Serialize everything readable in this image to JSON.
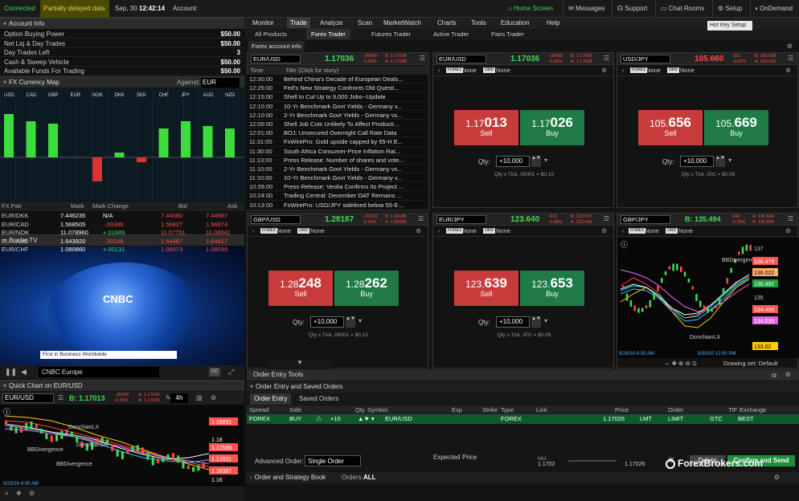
{
  "topbar": {
    "status": "Connected",
    "delay": "Partially delayed data",
    "date": "Sep, 30",
    "time": "12:42:14",
    "account_label": "Account:",
    "home": "Home Screen",
    "messages": "Messages",
    "support": "Support",
    "chat": "Chat Rooms",
    "setup": "Setup",
    "hotkey_tooltip": "Hot Key Setup",
    "ondemand": "OnDemand"
  },
  "account": {
    "title": "Account Info",
    "rows": [
      {
        "label": "Option Buying Power",
        "value": "$50.00"
      },
      {
        "label": "Net Liq & Day Trades",
        "value": "$50.00"
      },
      {
        "label": "Day Trades Left",
        "value": "3"
      },
      {
        "label": "Cash & Sweep Vehicle",
        "value": "$50.00"
      },
      {
        "label": "Available Funds For Trading",
        "value": "$50.00"
      }
    ]
  },
  "fxmap": {
    "title": "FX Currency Map",
    "against_label": "Against:",
    "against": "EUR",
    "currencies": [
      "USD",
      "CAD",
      "GBP",
      "EUR",
      "NOK",
      "DKK",
      "SEK",
      "CHF",
      "JPY",
      "AUD",
      "NZD"
    ]
  },
  "fxtable": {
    "headers": [
      "FX Pair",
      "Mark",
      "Mark Change",
      "Bid",
      "Ask"
    ],
    "rows": [
      {
        "pair": "EUR/DKK",
        "mark": "7.446235",
        "chg": "N/A",
        "bid": "7.44580",
        "ask": "7.44667"
      },
      {
        "pair": "EUR/CAD",
        "mark": "1.568505",
        "chg": "-.00386",
        "bid": "1.56827",
        "ask": "1.56874"
      },
      {
        "pair": "EUR/NOK",
        "mark": "11.078960",
        "chg": "+.01889",
        "bid": "11.07751",
        "ask": "11.08041"
      },
      {
        "pair": "EUR/AUD",
        "mark": "1.643920",
        "chg": "-.00249",
        "bid": "1.64367",
        "ask": "1.64417"
      },
      {
        "pair": "EUR/CHF",
        "mark": "1.080860",
        "chg": "+.00131",
        "bid": "1.08073",
        "ask": "1.08099"
      }
    ]
  },
  "tradertv": {
    "title": "Trader TV",
    "network": "CNBC Europe",
    "ticker": "First in Business Worldwide"
  },
  "quickchart": {
    "title": "Quick Chart on EUR/USD",
    "symbol": "EUR/USD",
    "bid": "B: 1.17013",
    "chg": "-.00426",
    "pct": "-0.36%",
    "a1": "A: 1.17026",
    "a2": "A: 1.17026",
    "tf": "4h",
    "labels": [
      "DonchianLX",
      "BBDivergence",
      "DonchianSE",
      "BBDivergence"
    ],
    "prices": [
      "1.18831",
      "1.18",
      "1.17566",
      "1.17011",
      "1.16367",
      "1.16"
    ],
    "date": "9/29/20 4:00 AM"
  },
  "menu": [
    "Monitor",
    "Trade",
    "Analyze",
    "Scan",
    "MarketWatch",
    "Charts",
    "Tools",
    "Education",
    "Help"
  ],
  "subtabs": [
    "All Products",
    "Forex Trader",
    "Futures Trader",
    "Active Trader",
    "Pairs Trader"
  ],
  "forexacct": "Forex account info",
  "news": {
    "sym": "EUR/USD",
    "price": "1.17036",
    "chg": "-.00405",
    "pct": "-0.35%",
    "b": "B: 1.17034",
    "a": "A: 1.17038",
    "col_time": "Time",
    "col_title": "Title (Click for story)",
    "items": [
      {
        "t": "12:30:00",
        "s": "Behind China's Decade of European Deals..."
      },
      {
        "t": "12:25:00",
        "s": "Fed's New Strategy Confronts Old Questi..."
      },
      {
        "t": "12:15:00",
        "s": "Shell to Cut Up to 9,000 Jobs--Update"
      },
      {
        "t": "12:10:00",
        "s": "10-Yr Benchmark Govt Yields - Germany v..."
      },
      {
        "t": "12:10:00",
        "s": "2-Yr Benchmark Govt Yields - Germany vs..."
      },
      {
        "t": "12:05:00",
        "s": "Shell Job Cuts Unlikely To Affect Producti..."
      },
      {
        "t": "12:01:00",
        "s": "BOJ: Unsecured Overnight Call Rate Data"
      },
      {
        "t": "11:31:00",
        "s": "FxWirePro: Gold upside capped by 55-H E..."
      },
      {
        "t": "11:30:00",
        "s": "South Africa Consumer-Price Inflation Rat..."
      },
      {
        "t": "11:13:00",
        "s": "Press Release: Number of shares and vote..."
      },
      {
        "t": "11:10:00",
        "s": "2-Yr Benchmark Govt Yields - Germany vs..."
      },
      {
        "t": "11:10:00",
        "s": "10-Yr Benchmark Govt Yields - Germany v..."
      },
      {
        "t": "10:39:00",
        "s": "Press Release: Veolia Confirms Its Project ..."
      },
      {
        "t": "10:24:00",
        "s": "Trading Central: December OAT Remains ..."
      },
      {
        "t": "10:13:00",
        "s": "FxWirePro: USD/JPY sidelined below 55-E..."
      }
    ]
  },
  "panels": [
    {
      "sym": "EUR/USD",
      "price": "1.17036",
      "chg": "-.00405",
      "pct": "-0.35%",
      "b": "B: 1.17034",
      "a": "A: 1.17038",
      "sellpre": "1.17",
      "sellbig": "013",
      "buypre": "1.17",
      "buybig": "026",
      "qty": "+10,000",
      "tick": "Qty x Tick .00001 = $0.10"
    },
    {
      "sym": "USD/JPY",
      "price": "105.660",
      "chg": ".011",
      "pct": "-0.01%",
      "b": "B: 105.658",
      "a": "A: 105.662",
      "sellpre": "105.",
      "sellbig": "656",
      "buypre": "105.",
      "buybig": "669",
      "qty": "+10,000",
      "tick": "Qty x Tick .001 = $0.09"
    },
    {
      "sym": "GBP/USD",
      "price": "1.28187",
      "chg": "-.00131",
      "pct": "-0.10%",
      "b": "B: 1.28185",
      "a": "A: 1.28189",
      "sellpre": "1.28",
      "sellbig": "248",
      "buypre": "1.28",
      "buybig": "262",
      "qty": "+10,000",
      "tick": "Qty x Tick .00001 = $0.10"
    },
    {
      "sym": "EUR/JPY",
      "price": "123.640",
      "chg": ".472",
      "pct": "-0.38%",
      "b": "B: 123.637",
      "a": "A: 123.643",
      "sellpre": "123.",
      "sellbig": "639",
      "buypre": "123.",
      "buybig": "653",
      "qty": "+10,000",
      "tick": "Qty x Tick .001 = $0.09"
    }
  ],
  "gbpjpy": {
    "sym": "GBP/JPY",
    "price": "B: 135.494",
    "chg": ".342",
    "pct": "-0.25%",
    "a1": "A: 135.504",
    "a2": "A: 135.504",
    "labels": [
      "BBDivergence",
      "DonchianLX"
    ],
    "prices": [
      "137",
      "136.479",
      "136.022",
      "135.492",
      "135",
      "134.496",
      "134.039",
      "133.02"
    ],
    "date": "9/28/20 4:00 AM",
    "date2": "9/30/20 12:00 PM",
    "drawing": "Drawing set: Default"
  },
  "common": {
    "none": "None",
    "sell": "Sell",
    "buy": "Buy",
    "qty_label": "Qty:"
  },
  "orders": {
    "tools": "Order Entry Tools",
    "oeso": "Order Entry and Saved Orders",
    "tab1": "Order Entry",
    "tab2": "Saved Orders",
    "headers": [
      "Spread",
      "Side",
      "Qty",
      "Symbol",
      "Exp",
      "Strike",
      "Type",
      "Link",
      "Price",
      "Order",
      "TIF",
      "Exchange"
    ],
    "row": {
      "spread": "FOREX",
      "side": "BUY",
      "qty": "+10",
      "symbol": "EUR/USD",
      "type": "FOREX",
      "price": "1.17026",
      "pricetype": "LMT",
      "order": "LIMIT",
      "tif": "GTC",
      "exchange": "BEST"
    },
    "adv_label": "Advanced Order:",
    "adv": "Single Order",
    "expected": "Expected",
    "expected_price": "Price",
    "mid": "Mid",
    "mid_val": "1.1702",
    "fav": "1.17026",
    "delete": "Delete",
    "confirm": "Confirm and Send",
    "bottom": "Order and Strategy Book",
    "orders_label": "Orders:",
    "orders_val": "ALL"
  },
  "watermark": "ForexBrokers.com"
}
